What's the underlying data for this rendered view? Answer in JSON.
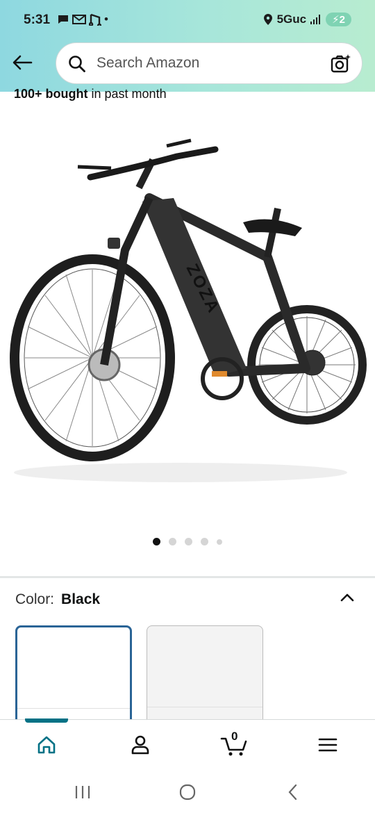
{
  "status": {
    "time": "5:31",
    "left_icons": [
      "message-icon",
      "gmail-icon",
      "music-icon"
    ],
    "dot": "•",
    "network": "5Guc",
    "battery": "2"
  },
  "search": {
    "placeholder": "Search Amazon"
  },
  "product": {
    "bought_bold": "100+ bought",
    "bought_rest": " in past month",
    "image_brand": "ZOZA",
    "image_index": 1,
    "image_count": 5
  },
  "color": {
    "label": "Color:",
    "value": "Black"
  },
  "bottom_nav": {
    "items": [
      "home-icon",
      "account-icon",
      "cart-icon",
      "menu-icon"
    ],
    "cart_count": "0",
    "active": "home"
  },
  "colors": {
    "accent": "#007185",
    "selected_border": "#2a6496"
  }
}
